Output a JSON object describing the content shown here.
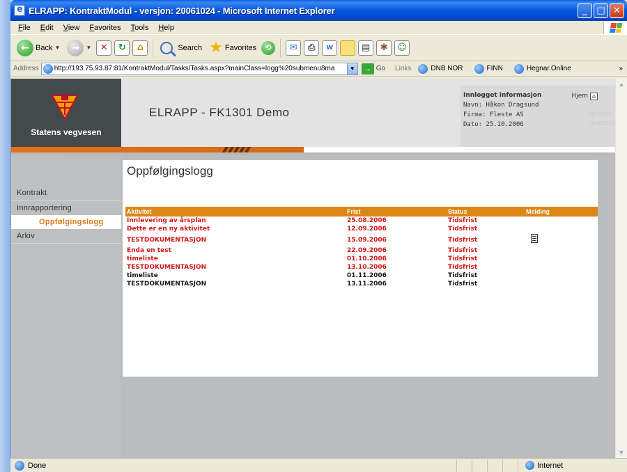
{
  "window": {
    "title": "ELRAPP: KontraktModul - versjon: 20061024 - Microsoft Internet Explorer"
  },
  "menu": [
    "File",
    "Edit",
    "View",
    "Favorites",
    "Tools",
    "Help"
  ],
  "toolbar": {
    "back": "Back",
    "search": "Search",
    "favorites": "Favorites"
  },
  "address": {
    "label": "Address",
    "url": "http://193.75.93.87:81/KontraktModul/Tasks/Tasks.aspx?mainClass=logg%20submenu8ma",
    "go": "Go",
    "links_label": "Links",
    "links": [
      "DNB NOR",
      "FINN",
      "Hegnar.Online"
    ]
  },
  "header": {
    "org": "Statens vegvesen",
    "app_title": "ELRAPP - FK1301 Demo",
    "info_title": "Innlogget informasjon",
    "home": "Hjem",
    "name_line": "Navn:  Håkon Dragsund",
    "firm_line": "Firma: Fleste AS",
    "date_line": "Dato:  25.10.2006",
    "version_label": "Versjon:",
    "version_value": "20061024"
  },
  "nav": {
    "items": [
      {
        "label": "Kontrakt"
      },
      {
        "label": "Innrapportering"
      },
      {
        "label": "Oppfølgingslogg"
      },
      {
        "label": "Arkiv"
      }
    ]
  },
  "main": {
    "title": "Oppfølgingslogg",
    "columns": [
      "Aktivitet",
      "Frist",
      "Status",
      "Melding"
    ],
    "rows": [
      {
        "aktivitet": "Innlevering av årsplan",
        "frist": "25.08.2006",
        "status": "Tidsfrist",
        "color": "red",
        "melding": false
      },
      {
        "aktivitet": "Dette er en ny aktivitet",
        "frist": "12.09.2006",
        "status": "Tidsfrist",
        "color": "red",
        "melding": false
      },
      {
        "aktivitet": "TESTDOKUMENTASJON",
        "frist": "15.09.2006",
        "status": "Tidsfrist",
        "color": "red",
        "melding": "document-icon"
      },
      {
        "aktivitet": "Enda en test",
        "frist": "22.09.2006",
        "status": "Tidsfrist",
        "color": "red",
        "melding": false
      },
      {
        "aktivitet": "timeliste",
        "frist": "01.10.2006",
        "status": "Tidsfrist",
        "color": "red",
        "melding": false
      },
      {
        "aktivitet": "TESTDOKUMENTASJON",
        "frist": "13.10.2006",
        "status": "Tidsfrist",
        "color": "red",
        "melding": false
      },
      {
        "aktivitet": "timeliste",
        "frist": "01.11.2006",
        "status": "Tidsfrist",
        "color": "dark",
        "melding": false
      },
      {
        "aktivitet": "TESTDOKUMENTASJON",
        "frist": "13.11.2006",
        "status": "Tidsfrist",
        "color": "dark",
        "melding": false
      }
    ]
  },
  "status": {
    "left": "Done",
    "zone": "Internet"
  },
  "colors": {
    "accent_orange": "#db8615",
    "overdue_red": "#d41717",
    "header_dark": "#44494c"
  }
}
